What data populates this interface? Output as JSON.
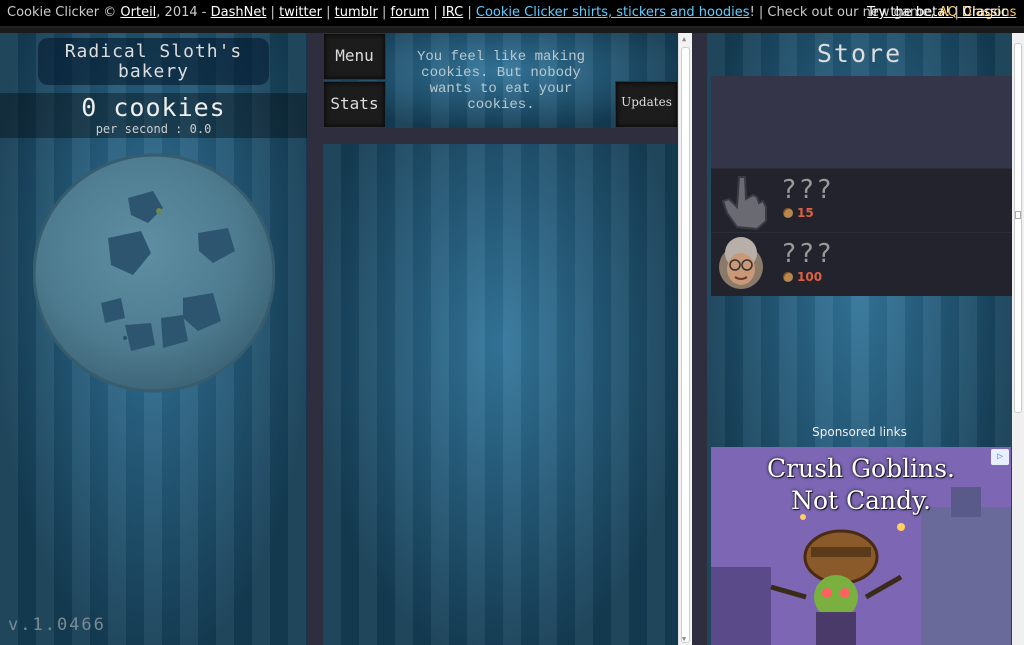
{
  "topbar": {
    "prefix": "Cookie Clicker © ",
    "author": "Orteil",
    "year": ", 2014 - ",
    "links": [
      "DashNet",
      "twitter",
      "tumblr",
      "forum",
      "IRC"
    ],
    "shop_link": "Cookie Clicker shirts, stickers and hoodies",
    "shop_suffix": "! | Check out our new game, ",
    "game_link": "AQ Dragons",
    "beta_link": "Try the beta!",
    "classic_link": "Classic"
  },
  "left": {
    "bakery_name": "Radical Sloth's bakery",
    "cookies": "0 cookies",
    "per_second": "per second : 0.0",
    "version": "v.1.0466"
  },
  "middle": {
    "menu_label": "Menu",
    "stats_label": "Stats",
    "updates_label": "Updates",
    "news": "You feel like making cookies. But nobody wants to eat your cookies."
  },
  "store": {
    "title": "Store",
    "products": [
      {
        "name": "???",
        "price": "15",
        "icon": "cursor-icon"
      },
      {
        "name": "???",
        "price": "100",
        "icon": "grandma-icon"
      }
    ]
  },
  "ad": {
    "sponsored_label": "Sponsored links",
    "headline_line1": "Crush Goblins.",
    "headline_line2": "Not Candy."
  },
  "colors": {
    "background": "#1f5c80",
    "panel": "#2e2e3e",
    "price": "#e06040",
    "link_blue": "#66ccff",
    "link_gold": "#ffcc66"
  }
}
